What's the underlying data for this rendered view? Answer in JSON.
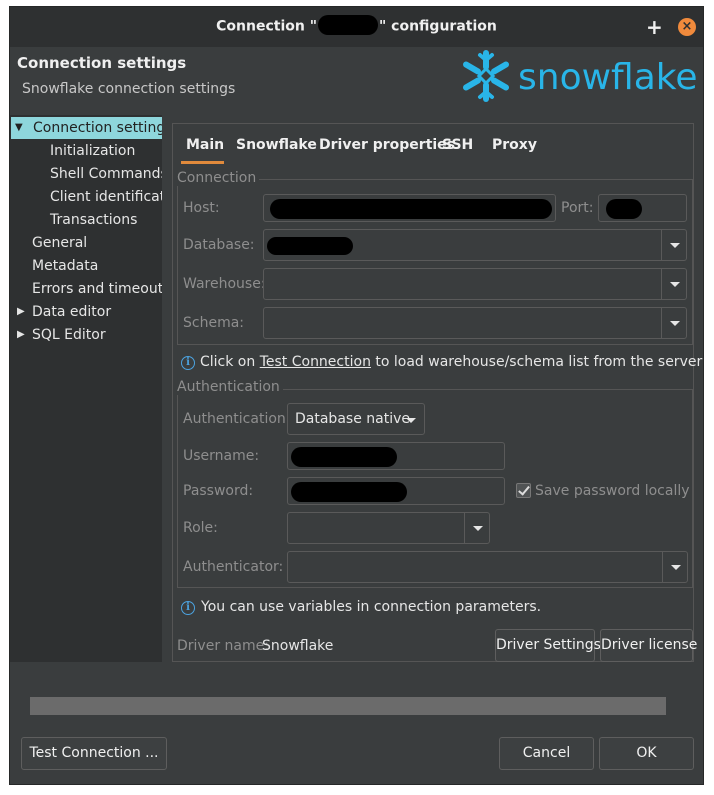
{
  "window": {
    "title_prefix": "Connection \"",
    "title_suffix": "\" configuration",
    "plus_icon": "+",
    "close_icon": "×"
  },
  "header": {
    "title": "Connection settings",
    "subtitle": "Snowflake connection settings",
    "logo_text": "snowflake",
    "logo_color": "#29b5e8"
  },
  "nav": {
    "items": [
      {
        "label": "Connection settings",
        "selected": true,
        "expanded": true
      },
      {
        "label": "Initialization"
      },
      {
        "label": "Shell Commands"
      },
      {
        "label": "Client identification"
      },
      {
        "label": "Transactions"
      },
      {
        "label": "General"
      },
      {
        "label": "Metadata"
      },
      {
        "label": "Errors and timeouts"
      },
      {
        "label": "Data editor",
        "expandable": true
      },
      {
        "label": "SQL Editor",
        "expandable": true
      }
    ]
  },
  "tabs": [
    "Main",
    "Snowflake",
    "Driver properties",
    "SSH",
    "Proxy"
  ],
  "connection": {
    "group_label": "Connection",
    "host_label": "Host:",
    "port_label": "Port:",
    "database_label": "Database:",
    "warehouse_label": "Warehouse:",
    "schema_label": "Schema:"
  },
  "info_load": {
    "prefix": "Click on ",
    "link": "Test Connection",
    "suffix": " to load warehouse/schema list from the server"
  },
  "auth": {
    "group_label": "Authentication",
    "auth_label": "Authentication:",
    "auth_value": "Database native",
    "username_label": "Username:",
    "password_label": "Password:",
    "save_password_label": "Save password locally",
    "save_password_checked": true,
    "role_label": "Role:",
    "authenticator_label": "Authenticator:"
  },
  "info_vars": "You can use variables in connection parameters.",
  "driver": {
    "name_label": "Driver name:",
    "name_value": "Snowflake",
    "settings_button": "Driver Settings",
    "license_button": "Driver license"
  },
  "footer": {
    "test_button": "Test Connection ...",
    "cancel_button": "Cancel",
    "ok_button": "OK"
  },
  "colors": {
    "accent": "#e08a3c",
    "selection": "#8ed6dc",
    "info": "#4ca3e0"
  }
}
